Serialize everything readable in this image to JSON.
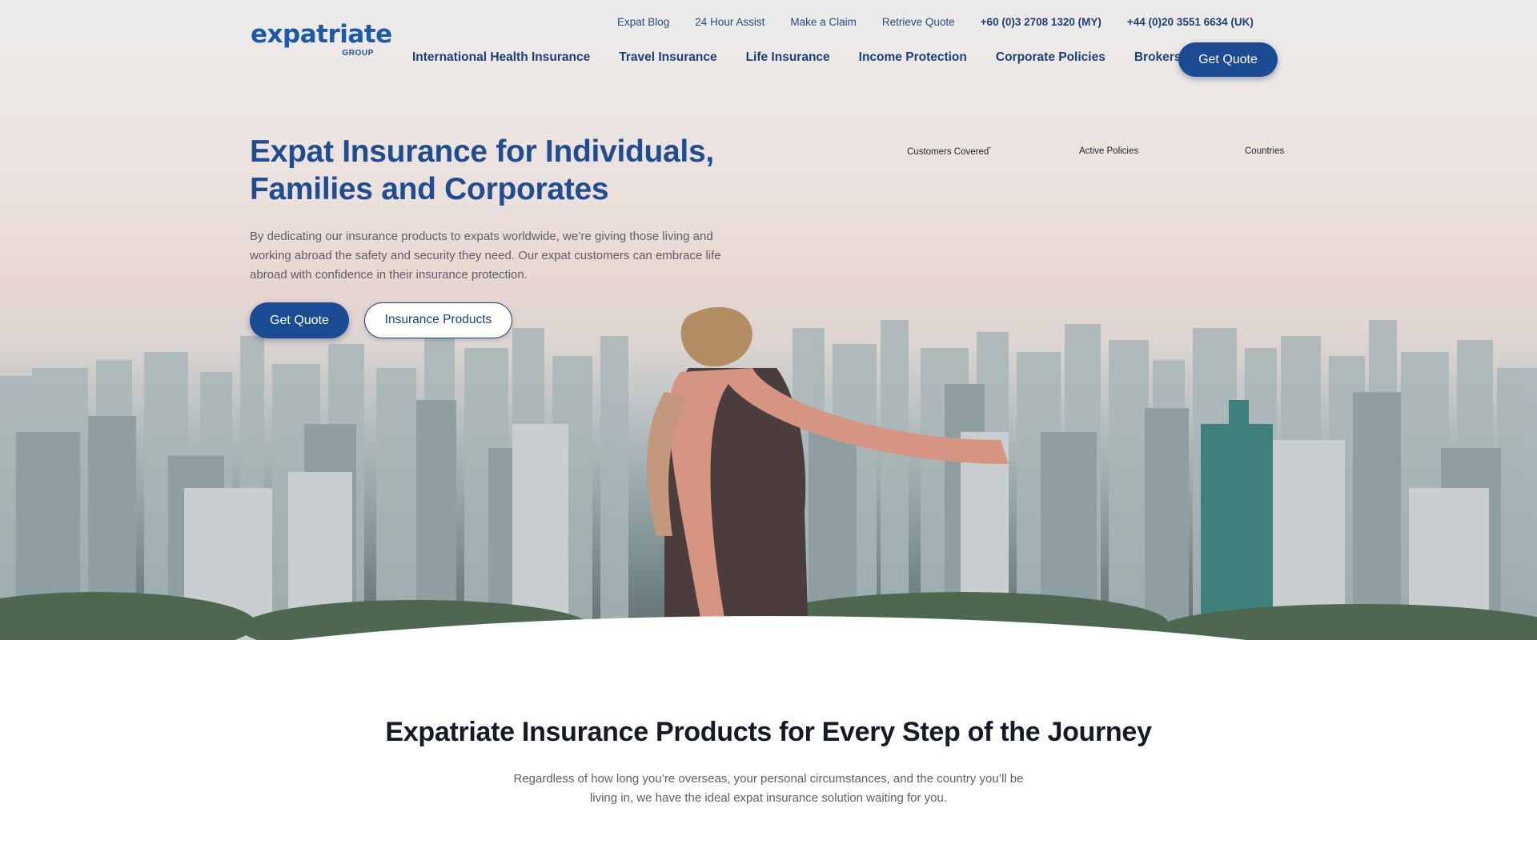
{
  "brand": {
    "logo_word": "expatriate",
    "logo_sub": "GROUP",
    "primary_color": "#1b4b93",
    "heading_color": "#1f4d8f"
  },
  "topbar": {
    "links": [
      "Expat Blog",
      "24 Hour Assist",
      "Make a Claim",
      "Retrieve Quote"
    ],
    "phone_my": "+60 (0)3 2708 1320 (MY)",
    "phone_uk": "+44 (0)20 3551 6634 (UK)"
  },
  "nav": {
    "items": [
      "International Health Insurance",
      "Travel Insurance",
      "Life Insurance",
      "Income Protection",
      "Corporate Policies",
      "Brokers"
    ],
    "cta": "Get Quote"
  },
  "hero": {
    "title": "Expat Insurance for Individuals, Families and Corporates",
    "text": "By dedicating our insurance products to expats worldwide, we’re giving those living and working abroad the safety and security they need. Our expat customers can embrace life abroad with confidence in their insurance protection.",
    "primary_button": "Get Quote",
    "secondary_button": "Insurance Products",
    "stats": {
      "customers_label": "Customers Covered",
      "customers_mark": "*",
      "policies_label": "Active Policies",
      "countries_label": "Countries"
    }
  },
  "products_section": {
    "title": "Expatriate Insurance Products for Every Step of the Journey",
    "text": "Regardless of how long you’re overseas, your personal circumstances, and the country you’ll be living in, we have the ideal expat insurance solution waiting for you."
  }
}
